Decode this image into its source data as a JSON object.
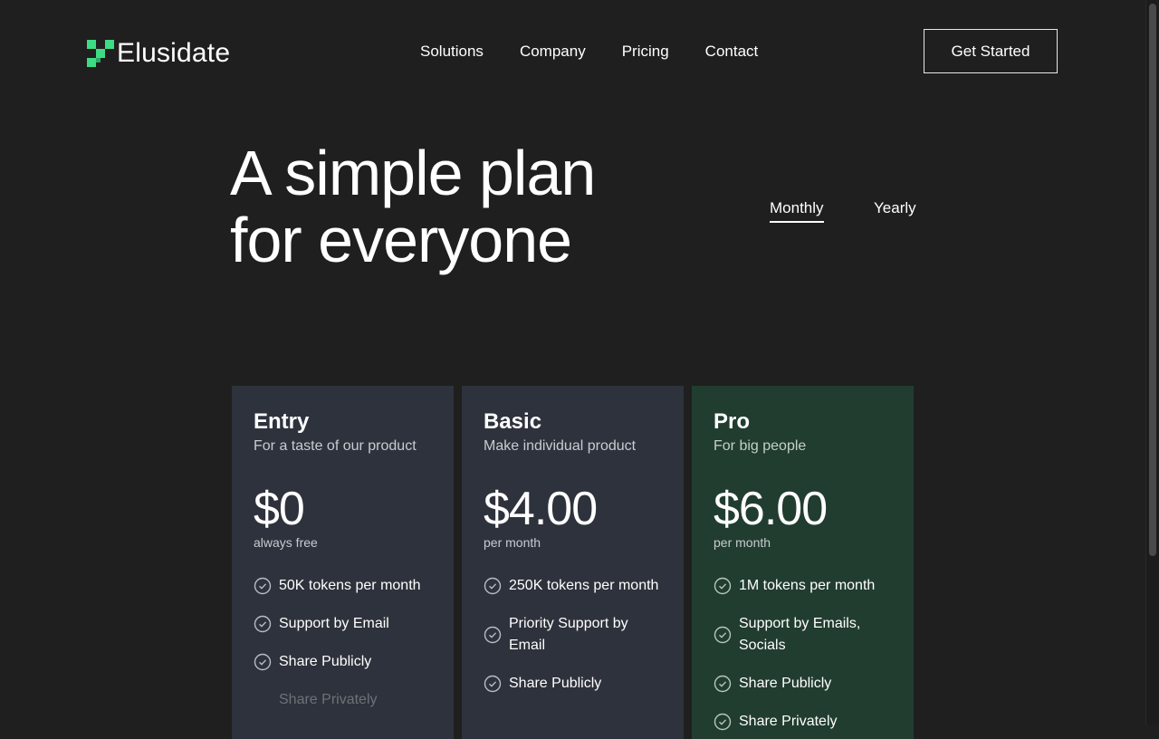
{
  "brand": {
    "name": "Elusidate",
    "accent": "#3ddc84"
  },
  "nav": {
    "items": [
      {
        "label": "Solutions"
      },
      {
        "label": "Company"
      },
      {
        "label": "Pricing"
      },
      {
        "label": "Contact"
      }
    ],
    "cta_label": "Get Started"
  },
  "hero": {
    "line1": "A simple plan",
    "line2": "for everyone"
  },
  "billing_toggle": {
    "monthly": "Monthly",
    "yearly": "Yearly",
    "selected": "Monthly"
  },
  "plans": [
    {
      "name": "Entry",
      "description": "For a taste of our product",
      "price": "$0",
      "period": "always free",
      "features": [
        {
          "text": "50K tokens per month",
          "included": true
        },
        {
          "text": "Support by Email",
          "included": true
        },
        {
          "text": "Share Publicly",
          "included": true
        },
        {
          "text": "Share Privately",
          "included": false
        }
      ]
    },
    {
      "name": "Basic",
      "description": "Make individual product",
      "price": "$4.00",
      "period": "per month",
      "features": [
        {
          "text": "250K tokens per month",
          "included": true
        },
        {
          "text": "Priority Support by Email",
          "included": true
        },
        {
          "text": "Share Publicly",
          "included": true
        }
      ]
    },
    {
      "name": "Pro",
      "description": "For big people",
      "price": "$6.00",
      "period": "per month",
      "features": [
        {
          "text": "1M tokens per month",
          "included": true
        },
        {
          "text": "Support by Emails, Socials",
          "included": true
        },
        {
          "text": "Share Publicly",
          "included": true
        },
        {
          "text": "Share Privately",
          "included": true
        }
      ]
    }
  ],
  "colors": {
    "background": "#1f1f1f",
    "card": "#2e323c",
    "card_pro": "#213d2f"
  }
}
